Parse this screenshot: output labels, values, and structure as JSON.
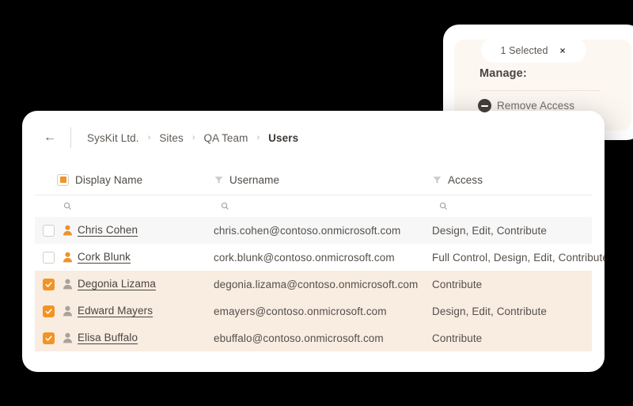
{
  "popup": {
    "selected_pill": {
      "label": "1 Selected",
      "close_icon": "close-icon",
      "close_glyph": "×"
    },
    "manage_label": "Manage:",
    "actions": [
      {
        "label": "Remove Access",
        "icon": "minus-circle-icon"
      }
    ]
  },
  "breadcrumb": {
    "back_icon": "back-arrow-icon",
    "back_glyph": "←",
    "separator": "›",
    "crumbs": [
      {
        "label": "SysKit Ltd.",
        "current": false
      },
      {
        "label": "Sites",
        "current": false
      },
      {
        "label": "QA Team",
        "current": false
      },
      {
        "label": "Users",
        "current": true
      }
    ]
  },
  "table": {
    "columns": [
      {
        "key": "display_name",
        "label": "Display Name",
        "icon": "checkbox-indeterminate-icon",
        "search_icon": "search-icon"
      },
      {
        "key": "username",
        "label": "Username",
        "icon": "filter-funnel-icon",
        "search_icon": "search-icon"
      },
      {
        "key": "access",
        "label": "Access",
        "icon": "filter-funnel-icon",
        "search_icon": "search-icon"
      }
    ],
    "rows": [
      {
        "display_name": "Chris Cohen",
        "username": "chris.cohen@contoso.onmicrosoft.com",
        "access": "Design, Edit, Contribute",
        "selected": false,
        "avatar_icon": "person-icon"
      },
      {
        "display_name": "Cork Blunk",
        "username": "cork.blunk@contoso.onmicrosoft.com",
        "access": "Full Control, Design, Edit, Contribute",
        "selected": false,
        "avatar_icon": "person-icon"
      },
      {
        "display_name": "Degonia Lizama",
        "username": "degonia.lizama@contoso.onmicrosoft.com",
        "access": "Contribute",
        "selected": true,
        "avatar_icon": "person-icon"
      },
      {
        "display_name": "Edward Mayers",
        "username": "emayers@contoso.onmicrosoft.com",
        "access": "Design, Edit, Contribute",
        "selected": true,
        "avatar_icon": "person-icon"
      },
      {
        "display_name": "Elisa Buffalo",
        "username": "ebuffalo@contoso.onmicrosoft.com",
        "access": "Contribute",
        "selected": true,
        "avatar_icon": "person-icon"
      }
    ]
  },
  "colors": {
    "accent_orange": "#f39323",
    "selected_row": "#f9ece1",
    "zebra_row": "#f7f7f7",
    "panel_cream": "#fcf7f1",
    "backdrop": "#000000",
    "avatar_orange": "#f0912c",
    "avatar_gray": "#a9a29c"
  }
}
